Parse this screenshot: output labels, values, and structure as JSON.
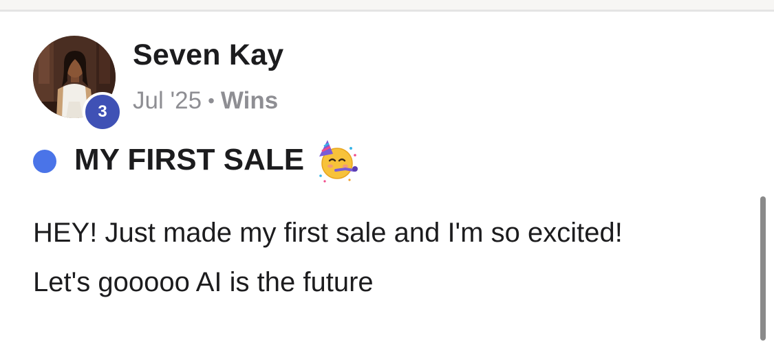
{
  "post": {
    "author": {
      "name": "Seven Kay",
      "level": "3"
    },
    "meta": {
      "date": "Jul '25",
      "separator": "•",
      "category": "Wins"
    },
    "title": "MY FIRST SALE",
    "title_emoji": "partying-face-icon",
    "unread_indicator_color": "#4a74e8",
    "body": "HEY! Just made my first sale and I'm so excited!\nLet's gooooo AI is the future"
  },
  "colors": {
    "badge": "#3f51b5",
    "meta_text": "#8e8e93",
    "text": "#1c1c1e"
  }
}
